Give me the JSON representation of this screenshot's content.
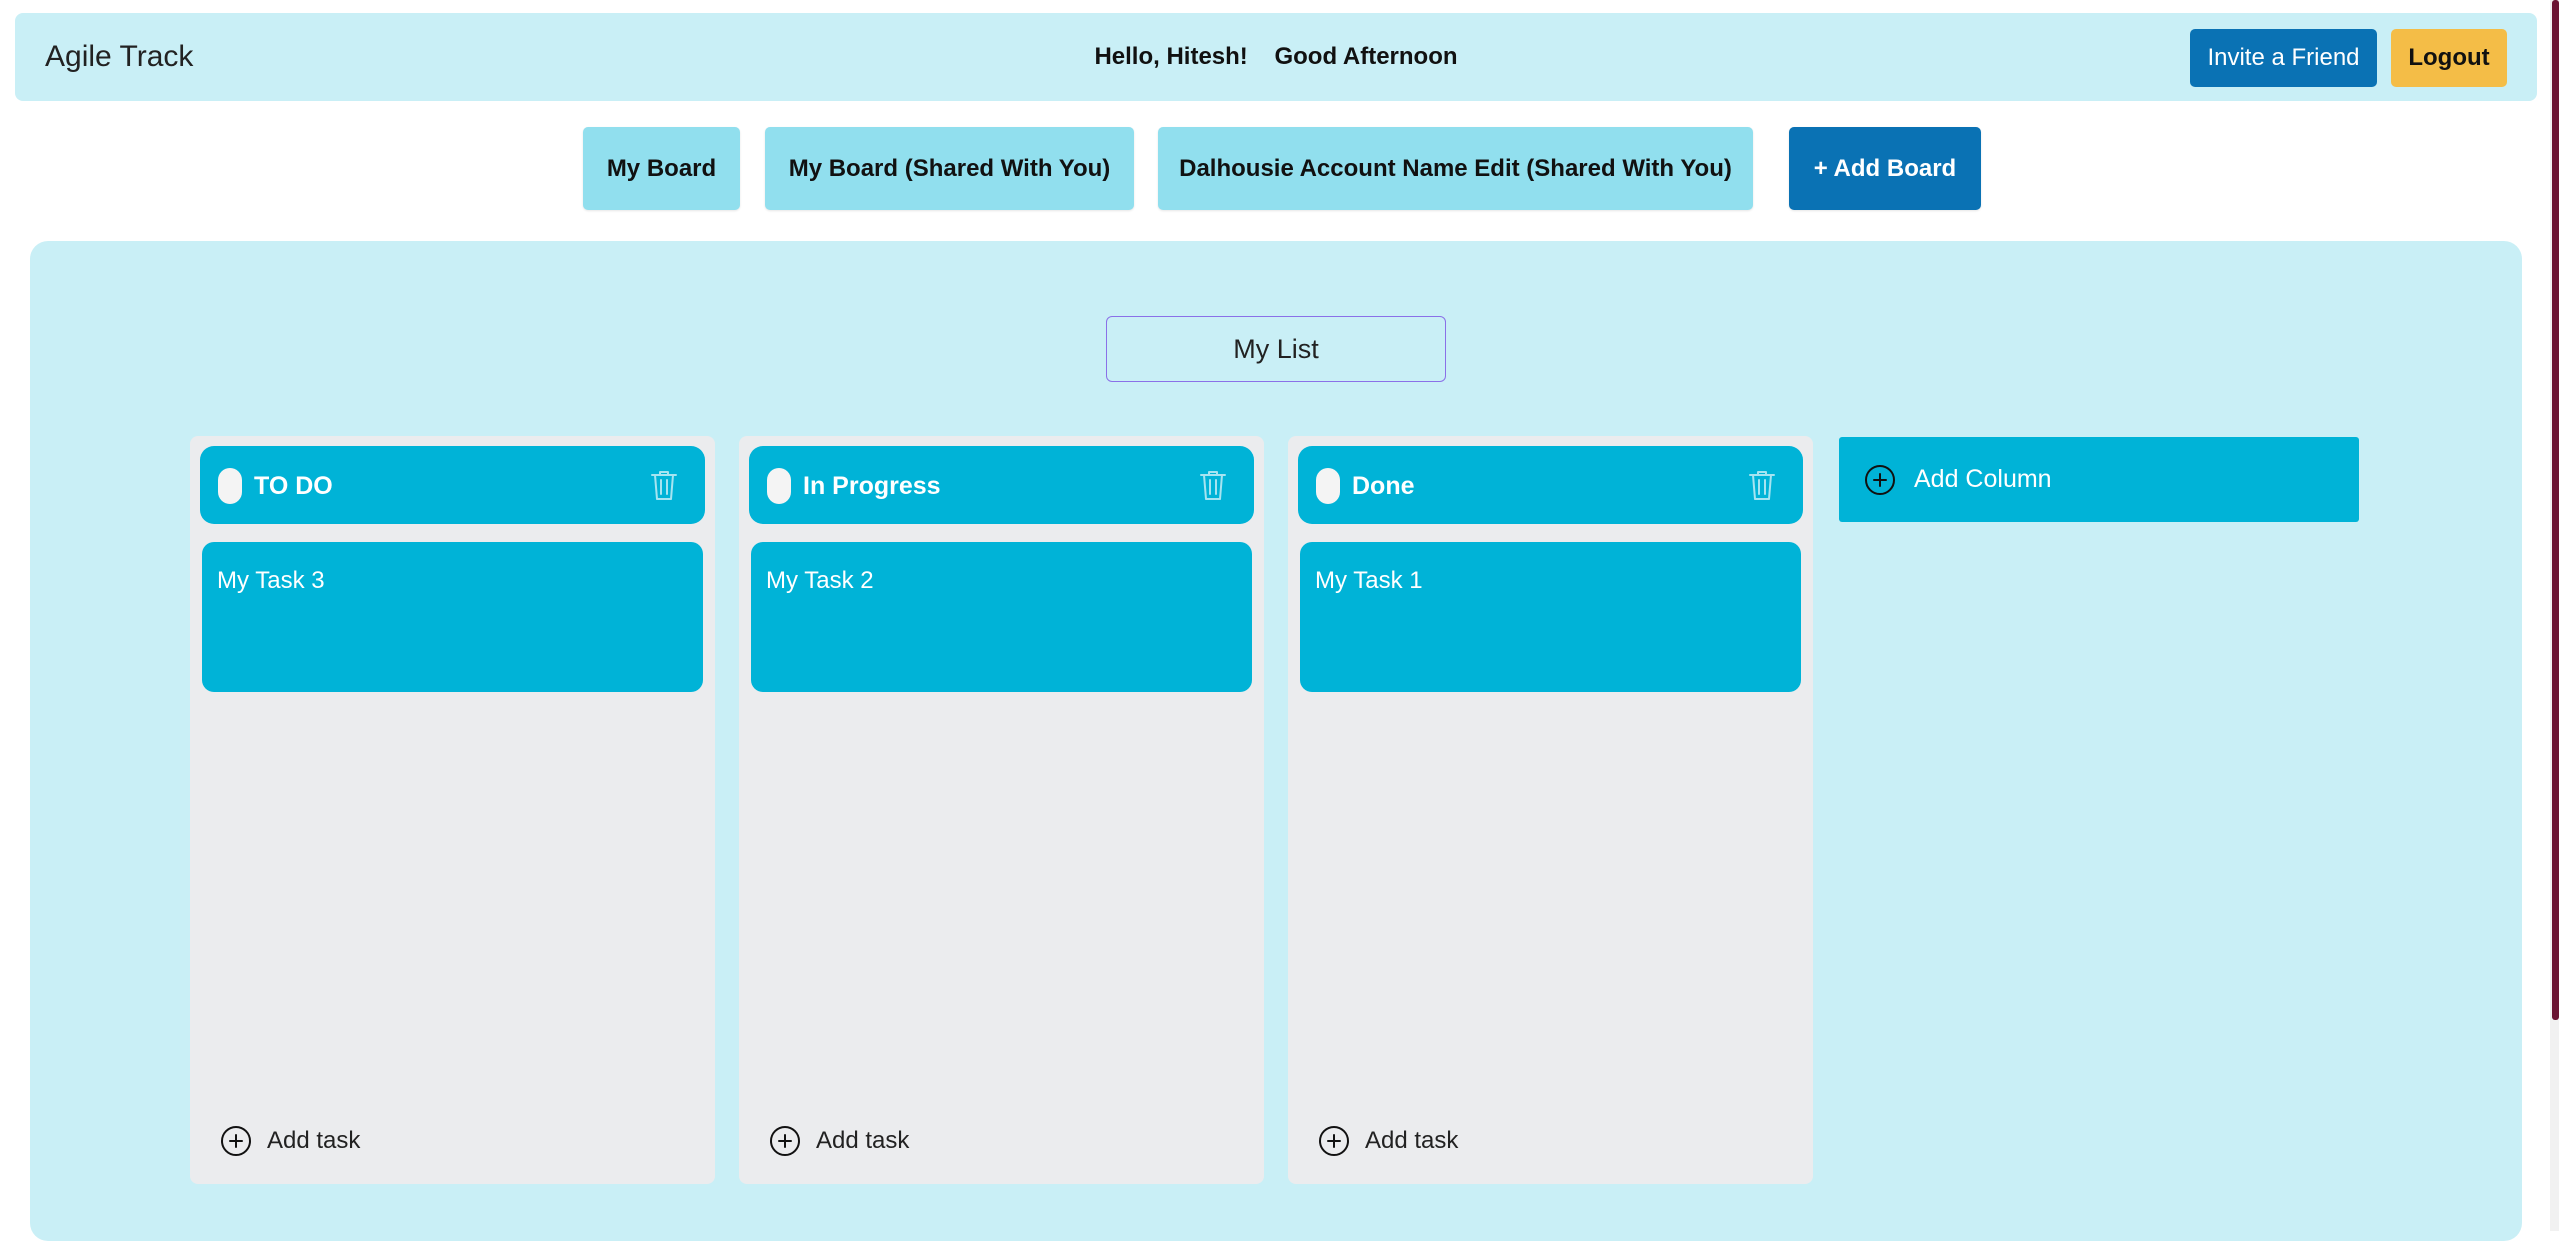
{
  "app": {
    "title": "Agile Track"
  },
  "header": {
    "greeting": "Hello, Hitesh!",
    "time_of_day": "Good Afternoon",
    "invite_label": "Invite a Friend",
    "logout_label": "Logout"
  },
  "boards": {
    "tabs": [
      {
        "label": "My Board"
      },
      {
        "label": "My Board (Shared With You)"
      },
      {
        "label": "Dalhousie Account Name Edit (Shared With You)"
      }
    ],
    "add_label": "+ Add Board"
  },
  "list": {
    "title": "My List"
  },
  "columns": [
    {
      "title": "TO DO",
      "tasks": [
        {
          "title": "My Task 3"
        }
      ],
      "add_task_label": "Add task"
    },
    {
      "title": "In Progress",
      "tasks": [
        {
          "title": "My Task 2"
        }
      ],
      "add_task_label": "Add task"
    },
    {
      "title": "Done",
      "tasks": [
        {
          "title": "My Task 1"
        }
      ],
      "add_task_label": "Add task"
    }
  ],
  "add_column_label": "Add Column",
  "icons": {
    "delete": "trash-icon",
    "add": "plus-circle-icon",
    "drag": "drag-handle-icon"
  },
  "colors": {
    "header_bg": "#c9eff6",
    "primary_blue": "#0a72b4",
    "logout_yellow": "#f4bd47",
    "tab_bg": "#91dfee",
    "column_header": "#00b3d7",
    "column_bg": "#ebecee",
    "list_border": "#8a70e8"
  }
}
